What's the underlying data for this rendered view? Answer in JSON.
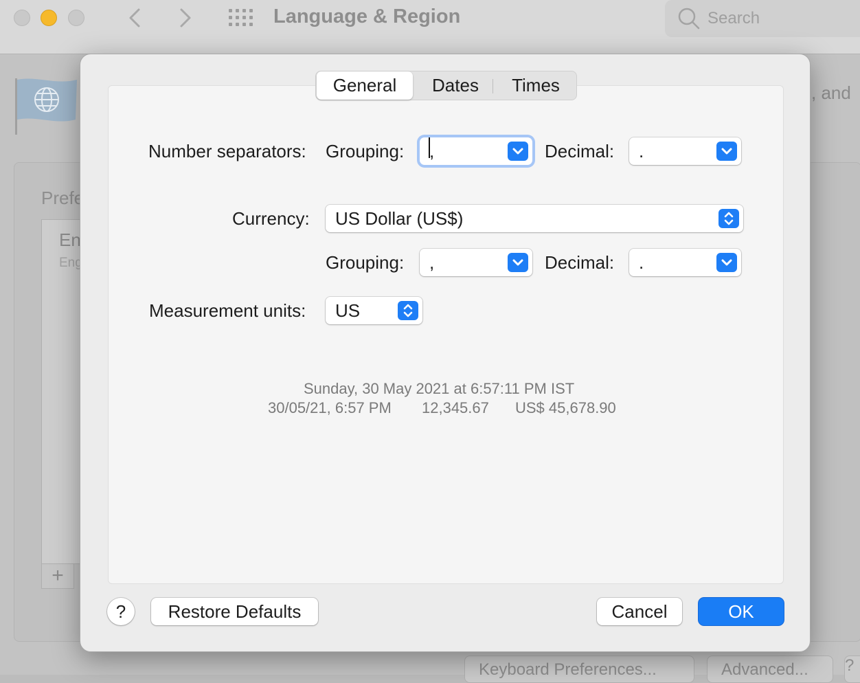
{
  "window": {
    "title": "Language & Region",
    "search_placeholder": "Search",
    "bg_right_text": "s, and",
    "bg_pref_label": "Prefe",
    "bg_list_item_title": "En",
    "bg_list_item_sub": "Eng",
    "bg_add": "+",
    "bg_button_keyboard": "Keyboard Preferences...",
    "bg_button_advanced": "Advanced...",
    "bg_button_help": "?"
  },
  "tabs": {
    "general": "General",
    "dates": "Dates",
    "times": "Times",
    "active": "general"
  },
  "number_separators": {
    "label": "Number separators:",
    "grouping_label": "Grouping:",
    "grouping_value": ",",
    "decimal_label": "Decimal:",
    "decimal_value": "."
  },
  "currency": {
    "label": "Currency:",
    "value": "US Dollar (US$)",
    "grouping_label": "Grouping:",
    "grouping_value": ",",
    "decimal_label": "Decimal:",
    "decimal_value": "."
  },
  "measurement": {
    "label": "Measurement units:",
    "value": "US"
  },
  "preview": {
    "line1": "Sunday, 30 May 2021 at 6:57:11 PM IST",
    "short_date": "30/05/21, 6:57 PM",
    "number": "12,345.67",
    "currency": "US$ 45,678.90"
  },
  "buttons": {
    "help": "?",
    "restore": "Restore Defaults",
    "cancel": "Cancel",
    "ok": "OK"
  },
  "colors": {
    "accent": "#1a7df5",
    "focus_ring": "#a6c6f6",
    "minimize": "#f6b92b"
  }
}
